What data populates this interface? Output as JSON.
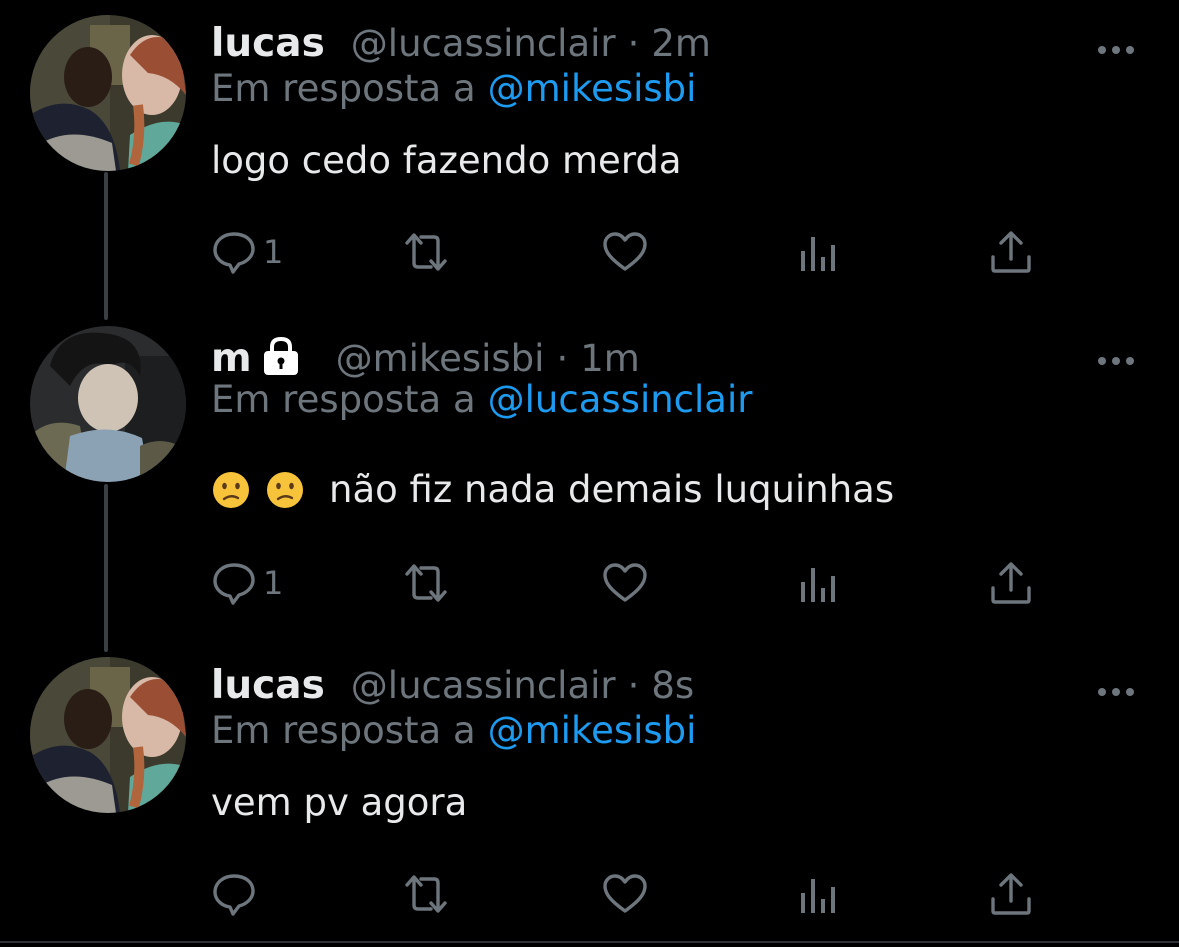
{
  "colors": {
    "background": "#000000",
    "text": "#e7e9ea",
    "secondary": "#6e767d",
    "link": "#1d9bf0",
    "thread_line": "#3a3f44"
  },
  "tweets": [
    {
      "display_name": "lucas",
      "handle": "@lucassinclair",
      "dot": "·",
      "time": "2m",
      "protected": false,
      "reply_prefix": "Em resposta a",
      "reply_to": "@mikesisbi",
      "text": "logo cedo fazendo merda",
      "emojis": [],
      "reply_count": "1",
      "avatar": "avatar-lucas"
    },
    {
      "display_name": "m",
      "handle": "@mikesisbi",
      "dot": "·",
      "time": "1m",
      "protected": true,
      "reply_prefix": "Em resposta a",
      "reply_to": "@lucassinclair",
      "text": "não fiz nada demais luquinhas",
      "emojis": [
        "confused-face",
        "confused-face"
      ],
      "reply_count": "1",
      "avatar": "avatar-mike"
    },
    {
      "display_name": "lucas",
      "handle": "@lucassinclair",
      "dot": "·",
      "time": "8s",
      "protected": false,
      "reply_prefix": "Em resposta a",
      "reply_to": "@mikesisbi",
      "text": "vem pv agora",
      "emojis": [],
      "reply_count": "",
      "avatar": "avatar-lucas"
    }
  ],
  "icons": {
    "more": "more-horizontal-icon",
    "reply": "reply-bubble-icon",
    "retweet": "retweet-icon",
    "like": "heart-icon",
    "views": "views-bar-chart-icon",
    "share": "share-upload-icon",
    "lock": "lock-icon"
  }
}
